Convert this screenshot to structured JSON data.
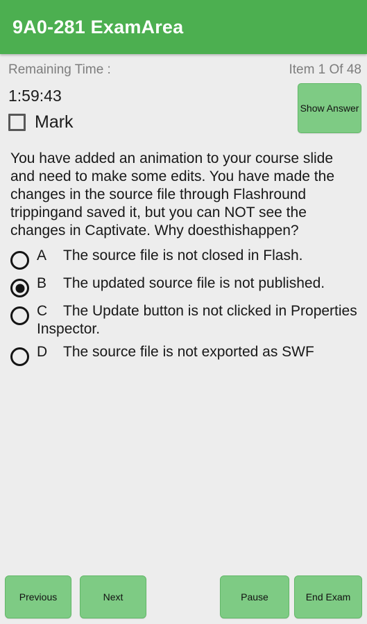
{
  "app": {
    "title": "9A0-281 ExamArea",
    "header_color": "#4caf50",
    "button_color": "#7ecb84",
    "background_color": "#ededed"
  },
  "status": {
    "remaining_time_label": "Remaining Time :",
    "item_counter": "Item 1 Of 48",
    "item_index": 1,
    "item_total": 48
  },
  "timer": {
    "value": "1:59:43"
  },
  "mark": {
    "label": "Mark",
    "checked": false
  },
  "show_answer": {
    "label": "Show Answer"
  },
  "question": {
    "text": "You have added an animation to your course slide and need to make some edits. You have made the changes in the source file through Flashround trippingand saved it, but you can NOT see the changes in Captivate. Why doesthishappen?"
  },
  "options": [
    {
      "letter": "A",
      "text": "The source file is not closed in Flash.",
      "selected": false
    },
    {
      "letter": "B",
      "text": "The updated source file is not published.",
      "selected": true
    },
    {
      "letter": "C",
      "text": "The Update button is not clicked in Properties Inspector.",
      "selected": false
    },
    {
      "letter": "D",
      "text": "The source file is not exported as SWF",
      "selected": false
    }
  ],
  "bottom_buttons": {
    "previous": "Previous",
    "next": "Next",
    "pause": "Pause",
    "end_exam": "End Exam"
  }
}
